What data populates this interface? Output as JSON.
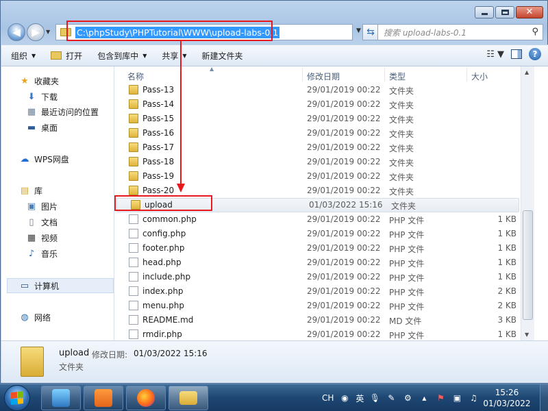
{
  "address": {
    "path": "C:\\phpStudy\\PHPTutorial\\WWW\\upload-labs-0.1",
    "search_placeholder": "搜索 upload-labs-0.1"
  },
  "toolbar": {
    "organize": "组织",
    "open": "打开",
    "include_library": "包含到库中",
    "share": "共享",
    "new_folder": "新建文件夹"
  },
  "navpane": {
    "favorites": "收藏夹",
    "downloads": "下载",
    "recent": "最近访问的位置",
    "desktop": "桌面",
    "wps": "WPS网盘",
    "libraries": "库",
    "pictures": "图片",
    "documents": "文档",
    "videos": "视频",
    "music": "音乐",
    "computer": "计算机",
    "network": "网络"
  },
  "columns": {
    "name": "名称",
    "date": "修改日期",
    "type": "类型",
    "size": "大小"
  },
  "files": [
    {
      "name": "Pass-13",
      "date": "29/01/2019 00:22",
      "type": "文件夹",
      "size": "",
      "kind": "folder"
    },
    {
      "name": "Pass-14",
      "date": "29/01/2019 00:22",
      "type": "文件夹",
      "size": "",
      "kind": "folder"
    },
    {
      "name": "Pass-15",
      "date": "29/01/2019 00:22",
      "type": "文件夹",
      "size": "",
      "kind": "folder"
    },
    {
      "name": "Pass-16",
      "date": "29/01/2019 00:22",
      "type": "文件夹",
      "size": "",
      "kind": "folder"
    },
    {
      "name": "Pass-17",
      "date": "29/01/2019 00:22",
      "type": "文件夹",
      "size": "",
      "kind": "folder"
    },
    {
      "name": "Pass-18",
      "date": "29/01/2019 00:22",
      "type": "文件夹",
      "size": "",
      "kind": "folder"
    },
    {
      "name": "Pass-19",
      "date": "29/01/2019 00:22",
      "type": "文件夹",
      "size": "",
      "kind": "folder"
    },
    {
      "name": "Pass-20",
      "date": "29/01/2019 00:22",
      "type": "文件夹",
      "size": "",
      "kind": "folder"
    },
    {
      "name": "upload",
      "date": "01/03/2022 15:16",
      "type": "文件夹",
      "size": "",
      "kind": "folder",
      "selected": true
    },
    {
      "name": "common.php",
      "date": "29/01/2019 00:22",
      "type": "PHP 文件",
      "size": "1 KB",
      "kind": "file"
    },
    {
      "name": "config.php",
      "date": "29/01/2019 00:22",
      "type": "PHP 文件",
      "size": "1 KB",
      "kind": "file"
    },
    {
      "name": "footer.php",
      "date": "29/01/2019 00:22",
      "type": "PHP 文件",
      "size": "1 KB",
      "kind": "file"
    },
    {
      "name": "head.php",
      "date": "29/01/2019 00:22",
      "type": "PHP 文件",
      "size": "1 KB",
      "kind": "file"
    },
    {
      "name": "include.php",
      "date": "29/01/2019 00:22",
      "type": "PHP 文件",
      "size": "1 KB",
      "kind": "file"
    },
    {
      "name": "index.php",
      "date": "29/01/2019 00:22",
      "type": "PHP 文件",
      "size": "2 KB",
      "kind": "file"
    },
    {
      "name": "menu.php",
      "date": "29/01/2019 00:22",
      "type": "PHP 文件",
      "size": "2 KB",
      "kind": "file"
    },
    {
      "name": "README.md",
      "date": "29/01/2019 00:22",
      "type": "MD 文件",
      "size": "3 KB",
      "kind": "file"
    },
    {
      "name": "rmdir.php",
      "date": "29/01/2019 00:22",
      "type": "PHP 文件",
      "size": "1 KB",
      "kind": "file"
    }
  ],
  "details": {
    "name": "upload",
    "modified_label": "修改日期:",
    "modified_value": "01/03/2022 15:16",
    "type": "文件夹"
  },
  "taskbar": {
    "input_lang": "CH",
    "ime": "英",
    "time": "15:26",
    "date": "01/03/2022"
  },
  "colors": {
    "highlight": "#e8181c",
    "selection": "#3399ff"
  }
}
